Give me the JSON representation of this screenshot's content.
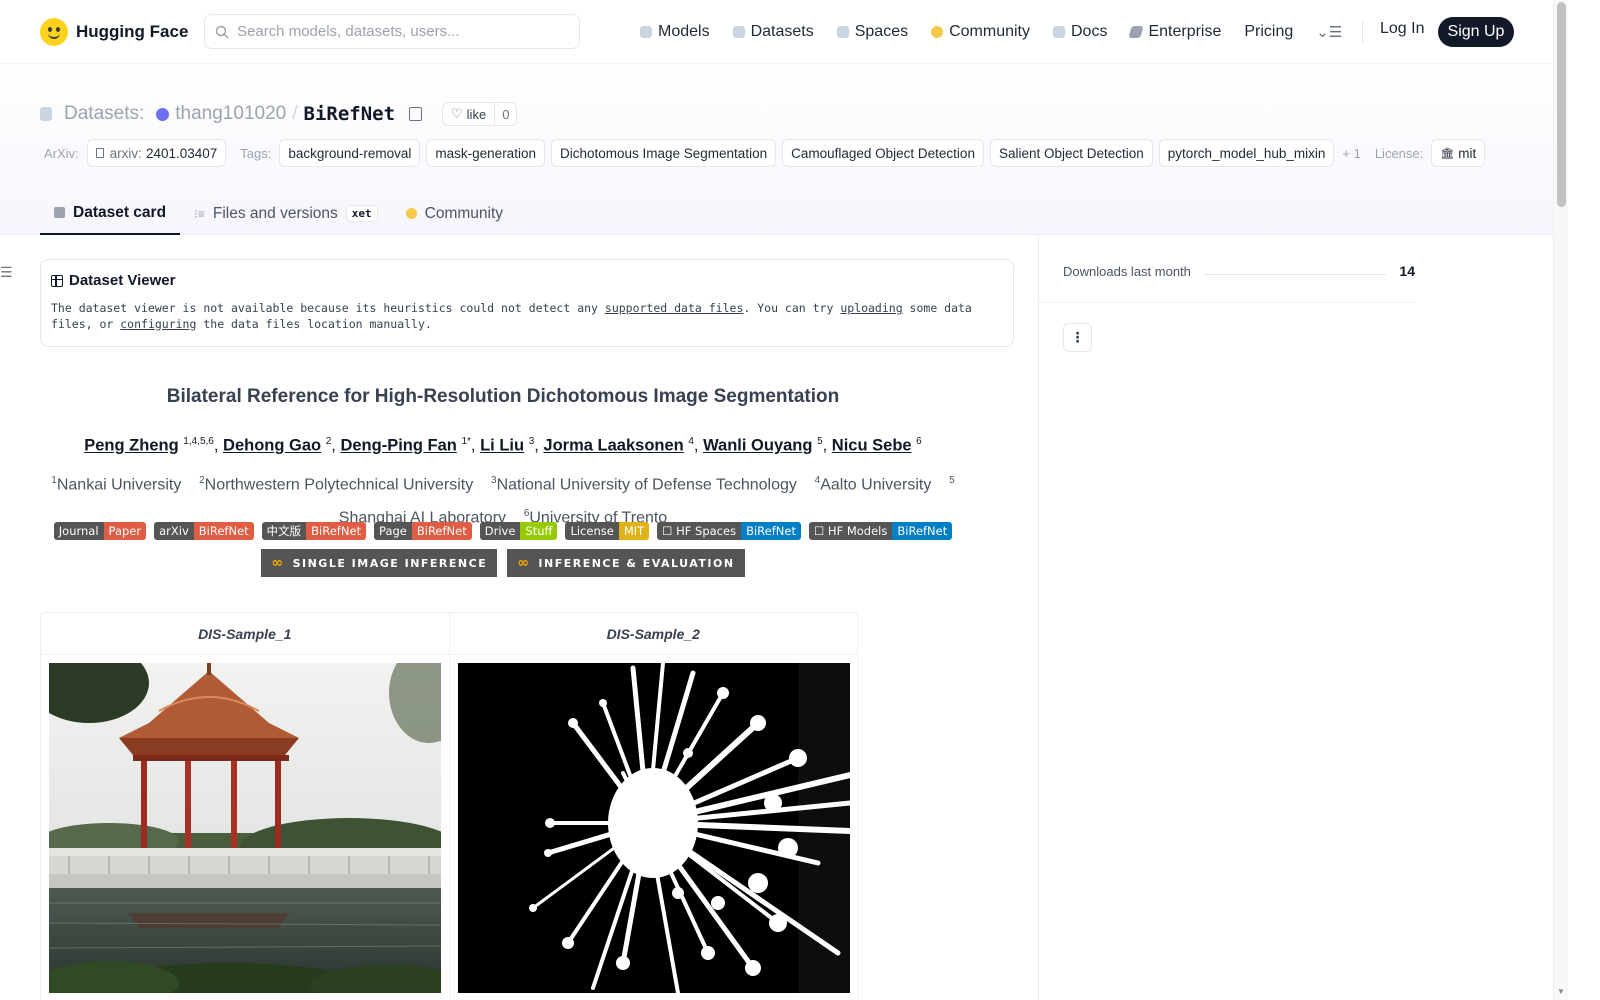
{
  "brand": {
    "name": "Hugging Face"
  },
  "search": {
    "placeholder": "Search models, datasets, users..."
  },
  "nav": {
    "items": [
      {
        "label": "Models",
        "icon": "cube-icon"
      },
      {
        "label": "Datasets",
        "icon": "database-icon"
      },
      {
        "label": "Spaces",
        "icon": "grid-icon"
      },
      {
        "label": "Community",
        "icon": "hugging-icon"
      },
      {
        "label": "Docs",
        "icon": "book-icon"
      },
      {
        "label": "Enterprise",
        "icon": "enterprise-icon"
      },
      {
        "label": "Pricing"
      }
    ],
    "login": "Log In",
    "signup": "Sign Up"
  },
  "header": {
    "type": "Datasets:",
    "owner": "thang101020",
    "repo": "BiRefNet",
    "like_label": "like",
    "like_count": "0",
    "arxiv_label": "ArXiv:",
    "arxiv_prefix": "arxiv:",
    "arxiv_id": "2401.03407",
    "tags_label": "Tags:",
    "tags": [
      "background-removal",
      "mask-generation",
      "Dichotomous Image Segmentation",
      "Camouflaged Object Detection",
      "Salient Object Detection",
      "pytorch_model_hub_mixin"
    ],
    "more_tags": "+ 1",
    "license_label": "License:",
    "license": "mit"
  },
  "tabs": [
    {
      "label": "Dataset card",
      "active": true
    },
    {
      "label": "Files and versions",
      "badge": "xet"
    },
    {
      "label": "Community"
    }
  ],
  "viewer": {
    "title": "Dataset Viewer",
    "text_1": "The dataset viewer is not available because its heuristics could not detect any ",
    "link_1": "supported data files",
    "text_2": ". You can try ",
    "link_2": "uploading",
    "text_3": " some data files, or ",
    "link_3": "configuring",
    "text_4": " the data files location manually."
  },
  "paper": {
    "title": "Bilateral Reference for High-Resolution Dichotomous Image Segmentation",
    "authors": [
      {
        "name": "Peng Zheng",
        "sup": "1,4,5,6"
      },
      {
        "name": "Dehong Gao",
        "sup": "2"
      },
      {
        "name": "Deng-Ping Fan",
        "sup": "1*"
      },
      {
        "name": "Li Liu",
        "sup": "3"
      },
      {
        "name": "Jorma Laaksonen",
        "sup": "4"
      },
      {
        "name": "Wanli Ouyang",
        "sup": "5"
      },
      {
        "name": "Nicu Sebe",
        "sup": "6"
      }
    ],
    "affiliations": [
      {
        "sup": "1",
        "name": "Nankai University"
      },
      {
        "sup": "2",
        "name": "Northwestern Polytechnical University"
      },
      {
        "sup": "3",
        "name": "National University of Defense Technology"
      },
      {
        "sup": "4",
        "name": "Aalto University"
      },
      {
        "sup": "5",
        "name": "Shanghai AI Laboratory"
      },
      {
        "sup": "6",
        "name": "University of Trento"
      }
    ],
    "badges": [
      {
        "left": "Journal",
        "right": "Paper",
        "color": "#e05d44"
      },
      {
        "left": "arXiv",
        "right": "BiRefNet",
        "color": "#e05d44"
      },
      {
        "left": "中文版",
        "right": "BiRefNet",
        "color": "#e05d44"
      },
      {
        "left": "Page",
        "right": "BiRefNet",
        "color": "#e05d44"
      },
      {
        "left": "Drive",
        "right": "Stuff",
        "color": "#97ca00"
      },
      {
        "left": "License",
        "right": "MIT",
        "color": "#dfb317"
      },
      {
        "left": "☐ HF Spaces",
        "right": "BiRefNet",
        "color": "#007ec6"
      },
      {
        "left": "☐ HF Models",
        "right": "BiRefNet",
        "color": "#007ec6"
      }
    ],
    "buttons": [
      "SINGLE IMAGE INFERENCE",
      "INFERENCE & EVALUATION"
    ]
  },
  "samples": {
    "headers": [
      "DIS-Sample_1",
      "DIS-Sample_2"
    ]
  },
  "sidebar": {
    "downloads_label": "Downloads last month",
    "downloads_value": "14"
  },
  "colors": {
    "accent": "#111827",
    "owner_dot": "#6d6ff1",
    "brand_yellow": "#FFD21E"
  }
}
